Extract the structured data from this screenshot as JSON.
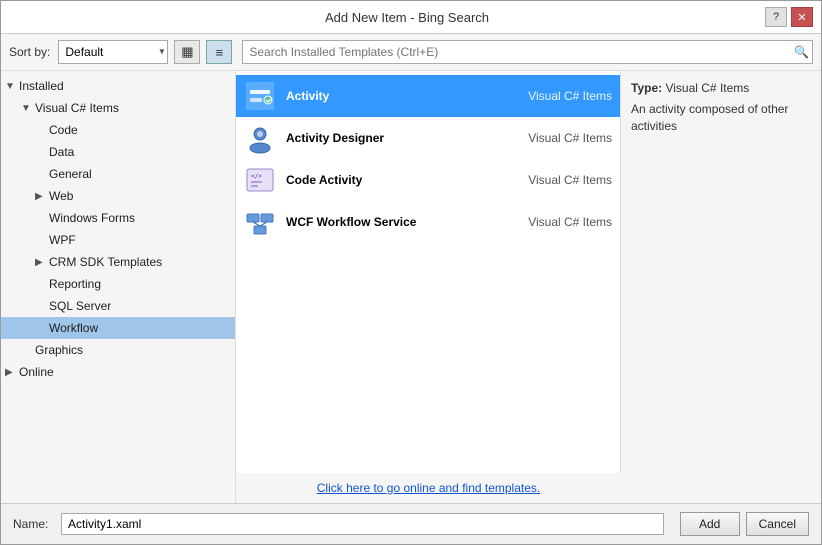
{
  "dialog": {
    "title": "Add New Item - Bing Search",
    "help_btn": "?",
    "close_btn": "✕"
  },
  "toolbar": {
    "sort_label": "Sort by:",
    "sort_default": "Default",
    "search_placeholder": "Search Installed Templates (Ctrl+E)",
    "view_grid_icon": "⊞",
    "view_list_icon": "≡"
  },
  "sidebar": {
    "sections": [
      {
        "id": "installed",
        "label": "Installed",
        "level": 0,
        "expanded": true,
        "has_expander": true
      },
      {
        "id": "visual-cs-items",
        "label": "Visual C# Items",
        "level": 1,
        "expanded": true,
        "has_expander": true
      },
      {
        "id": "code",
        "label": "Code",
        "level": 2,
        "expanded": false,
        "has_expander": false
      },
      {
        "id": "data",
        "label": "Data",
        "level": 2,
        "expanded": false,
        "has_expander": false
      },
      {
        "id": "general",
        "label": "General",
        "level": 2,
        "expanded": false,
        "has_expander": false
      },
      {
        "id": "web",
        "label": "Web",
        "level": 2,
        "expanded": false,
        "has_expander": true
      },
      {
        "id": "windows-forms",
        "label": "Windows Forms",
        "level": 2,
        "expanded": false,
        "has_expander": false
      },
      {
        "id": "wpf",
        "label": "WPF",
        "level": 2,
        "expanded": false,
        "has_expander": false
      },
      {
        "id": "crm-sdk",
        "label": "CRM SDK Templates",
        "level": 2,
        "expanded": false,
        "has_expander": true
      },
      {
        "id": "reporting",
        "label": "Reporting",
        "level": 2,
        "expanded": false,
        "has_expander": false
      },
      {
        "id": "sql-server",
        "label": "SQL Server",
        "level": 2,
        "expanded": false,
        "has_expander": false
      },
      {
        "id": "workflow",
        "label": "Workflow",
        "level": 2,
        "expanded": false,
        "has_expander": false,
        "selected": true
      },
      {
        "id": "graphics",
        "label": "Graphics",
        "level": 1,
        "expanded": false,
        "has_expander": false
      },
      {
        "id": "online",
        "label": "Online",
        "level": 0,
        "expanded": false,
        "has_expander": true
      }
    ]
  },
  "items": [
    {
      "id": "activity",
      "name": "Activity",
      "category": "Visual C# Items",
      "selected": true,
      "icon_type": "activity"
    },
    {
      "id": "activity-designer",
      "name": "Activity Designer",
      "category": "Visual C# Items",
      "selected": false,
      "icon_type": "activity-designer"
    },
    {
      "id": "code-activity",
      "name": "Code Activity",
      "category": "Visual C# Items",
      "selected": false,
      "icon_type": "code-activity"
    },
    {
      "id": "wcf-workflow",
      "name": "WCF Workflow Service",
      "category": "Visual C# Items",
      "selected": false,
      "icon_type": "wcf-workflow"
    }
  ],
  "online_link": "Click here to go online and find templates.",
  "info_panel": {
    "type_label": "Type:",
    "type_value": "Visual C# Items",
    "description": "An activity composed of other activities"
  },
  "bottom": {
    "name_label": "Name:",
    "name_value": "Activity1.xaml",
    "add_btn": "Add",
    "cancel_btn": "Cancel"
  }
}
